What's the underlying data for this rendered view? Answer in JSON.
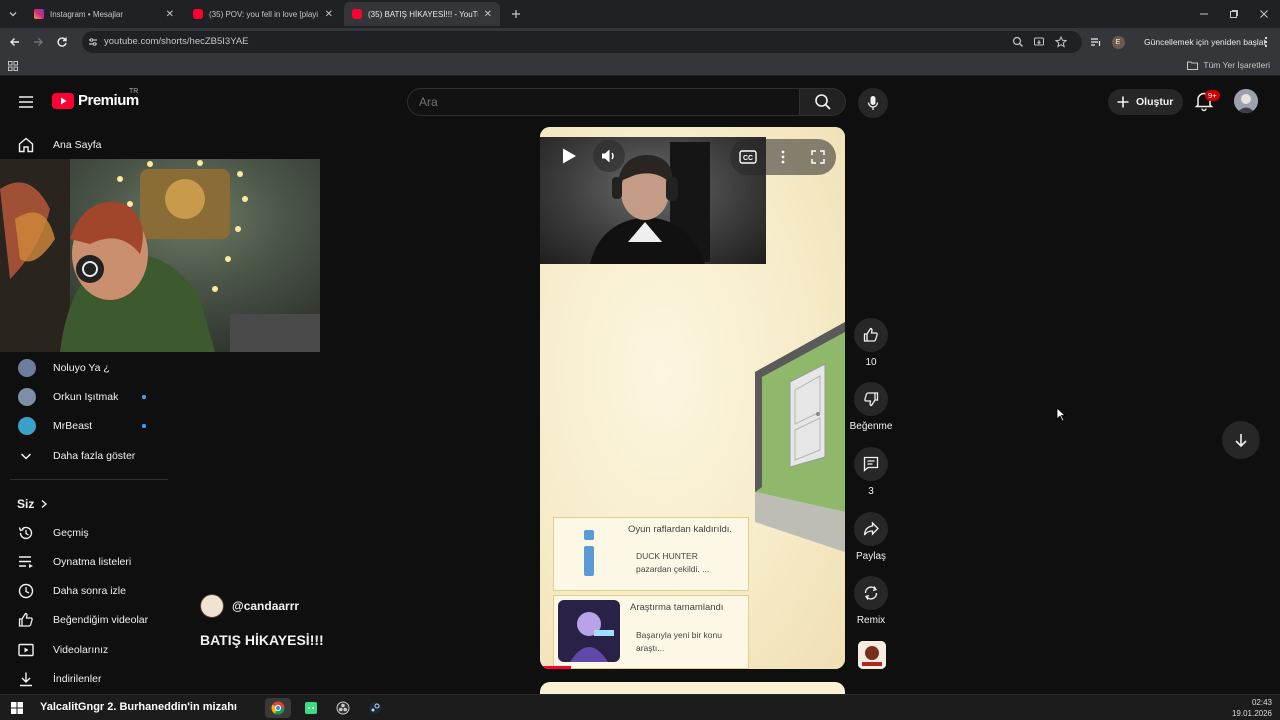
{
  "browser": {
    "tabs": [
      {
        "title": "Instagram • Mesajlar",
        "favicon": "instagram-icon",
        "active": false
      },
      {
        "title": "(35) POV: you fell in love [playi",
        "favicon": "youtube-icon",
        "active": false
      },
      {
        "title": "(35) BATIŞ HİKAYESİ!!! - YouTub",
        "favicon": "youtube-icon",
        "active": true
      }
    ],
    "url": "youtube.com/shorts/hecZB5I3YAE",
    "profile_initial": "E",
    "restart_label": "Güncellemek için yeniden başlat",
    "bookmarks_label": "Tüm Yer İşaretleri"
  },
  "header": {
    "logo_text": "Premium",
    "region": "TR",
    "search_placeholder": "Ara",
    "create_label": "Oluştur",
    "notification_count": "9+"
  },
  "sidebar": {
    "home_label": "Ana Sayfa",
    "subscriptions": [
      {
        "name": "Noluyo Ya ¿",
        "live": false,
        "color": "#6b7f9a"
      },
      {
        "name": "Orkun Işıtmak",
        "live": true,
        "color": "#7b8fa6"
      },
      {
        "name": "MrBeast",
        "live": true,
        "color": "#3aa0c8"
      }
    ],
    "show_more_label": "Daha fazla göster",
    "you_section": "Siz",
    "you_items": [
      {
        "label": "Geçmiş",
        "icon": "history-icon"
      },
      {
        "label": "Oynatma listeleri",
        "icon": "playlist-icon"
      },
      {
        "label": "Daha sonra izle",
        "icon": "clock-icon"
      },
      {
        "label": "Beğendiğim videolar",
        "icon": "thumbs-up-icon"
      },
      {
        "label": "Videolarınız",
        "icon": "video-icon"
      },
      {
        "label": "İndirilenler",
        "icon": "download-icon"
      }
    ]
  },
  "short": {
    "channel": "@candaarrr",
    "title": "BATIŞ HİKAYESİ!!!",
    "progress": 0.1,
    "game_cards": [
      {
        "title": "Oyun raflardan kaldırıldı.",
        "body_line1": "DUCK HUNTER",
        "body_line2": "pazardan çekildi. ..."
      },
      {
        "title": "Araştırma tamamlandı",
        "body_line1": "Başarıyla yeni bir konu",
        "body_line2": "araştı..."
      }
    ],
    "actions": {
      "like_count": "10",
      "dislike_label": "Beğenme",
      "comment_count": "3",
      "share_label": "Paylaş",
      "remix_label": "Remix"
    }
  },
  "taskbar": {
    "marquee_text": "YalcalitGngr 2. Burhaneddin'in mizahı",
    "time": "02:43",
    "date": "19.01.2026"
  },
  "colors": {
    "accent": "#ff0033",
    "live_dot": "#3ea6ff",
    "background": "#0f0f0f"
  }
}
